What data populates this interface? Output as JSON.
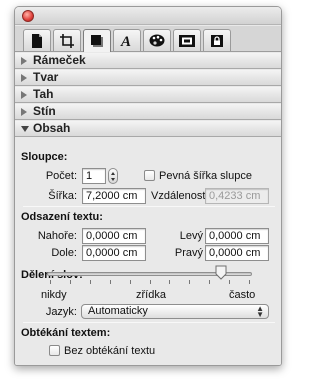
{
  "sections": [
    {
      "label": "Rámeček",
      "expanded": false
    },
    {
      "label": "Tvar",
      "expanded": false
    },
    {
      "label": "Tah",
      "expanded": false
    },
    {
      "label": "Stín",
      "expanded": false
    },
    {
      "label": "Obsah",
      "expanded": true
    }
  ],
  "tabs": [
    {
      "name": "document-icon"
    },
    {
      "name": "crop-frame-icon"
    },
    {
      "name": "graphic-shape-icon",
      "active": true
    },
    {
      "name": "text-style-icon"
    },
    {
      "name": "color-palette-icon"
    },
    {
      "name": "image-filmstrip-icon"
    },
    {
      "name": "lock-icon"
    }
  ],
  "obsah": {
    "columns": {
      "heading": "Sloupce:",
      "count_label": "Počet:",
      "count_value": "1",
      "fixed_width_label": "Pevná šířka slupce",
      "fixed_width_checked": false,
      "width_label": "Šířka:",
      "width_value": "7,2000 cm",
      "gap_label": "Vzdálenost:",
      "gap_value": "0,4233 cm"
    },
    "text_inset": {
      "heading": "Odsazení textu:",
      "top_label": "Nahoře:",
      "top_value": "0,0000 cm",
      "left_label": "Levý",
      "left_value": "0,0000 cm",
      "bottom_label": "Dole:",
      "bottom_value": "0,0000 cm",
      "right_label": "Pravý",
      "right_value": "0,0000 cm"
    },
    "hyphenation": {
      "heading": "Dělení slov:",
      "slider_min_label": "nikdy",
      "slider_mid_label": "zřídka",
      "slider_max_label": "často",
      "slider_ticks": 11,
      "slider_value": 0.85,
      "language_label": "Jazyk:",
      "language_value": "Automaticky"
    },
    "wrap": {
      "heading": "Obtékání textem:",
      "no_wrap_label": "Bez obtékání textu",
      "no_wrap_checked": false
    }
  }
}
